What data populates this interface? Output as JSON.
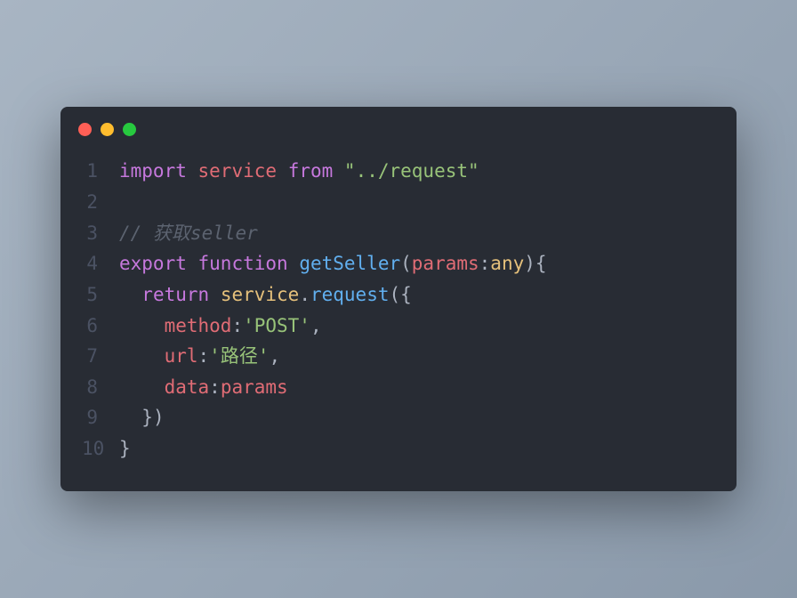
{
  "titlebar": {
    "red": "close-button",
    "yellow": "minimize-button",
    "green": "maximize-button"
  },
  "lines": [
    {
      "num": "1"
    },
    {
      "num": "2"
    },
    {
      "num": "3"
    },
    {
      "num": "4"
    },
    {
      "num": "5"
    },
    {
      "num": "6"
    },
    {
      "num": "7"
    },
    {
      "num": "8"
    },
    {
      "num": "9"
    },
    {
      "num": "10"
    }
  ],
  "code": {
    "l1": {
      "import": "import",
      "service": "service",
      "from": "from",
      "path": "\"../request\""
    },
    "l3": {
      "comment": "// 获取seller"
    },
    "l4": {
      "export": "export",
      "function": "function",
      "name": "getSeller",
      "lparen": "(",
      "param": "params",
      "colon": ":",
      "type": "any",
      "rparen": ")",
      "lbrace": "{"
    },
    "l5": {
      "indent": "  ",
      "return": "return",
      "service": "service",
      "dot": ".",
      "request": "request",
      "lparen": "(",
      "lbrace": "{"
    },
    "l6": {
      "indent": "    ",
      "key": "method",
      "colon": ":",
      "val": "'POST'",
      "comma": ","
    },
    "l7": {
      "indent": "    ",
      "key": "url",
      "colon": ":",
      "val": "'路径'",
      "comma": ","
    },
    "l8": {
      "indent": "    ",
      "key": "data",
      "colon": ":",
      "val": "params"
    },
    "l9": {
      "indent": "  ",
      "rbrace": "}",
      "rparen": ")"
    },
    "l10": {
      "rbrace": "}"
    }
  }
}
